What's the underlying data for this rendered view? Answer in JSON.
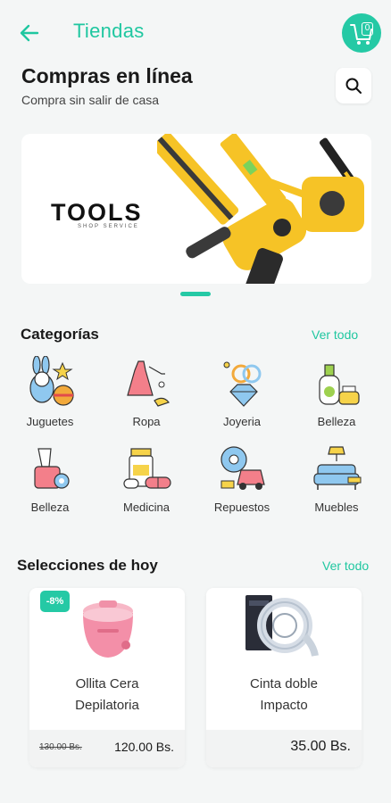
{
  "header": {
    "title": "Tiendas",
    "cart_count": "0"
  },
  "intro": {
    "heading": "Compras en línea",
    "subheading": "Compra sin salir de casa"
  },
  "banner": {
    "brand": "TOOLS",
    "tagline": "SHOP SERVICE"
  },
  "categories": {
    "title": "Categorías",
    "see_all": "Ver todo",
    "items": [
      {
        "label": "Juguetes",
        "icon": "toys-icon"
      },
      {
        "label": "Ropa",
        "icon": "dress-icon"
      },
      {
        "label": "Joyeria",
        "icon": "jewelry-icon"
      },
      {
        "label": "Belleza",
        "icon": "cosmetics-icon"
      },
      {
        "label": "Belleza",
        "icon": "makeup-icon"
      },
      {
        "label": "Medicina",
        "icon": "medicine-icon"
      },
      {
        "label": "Repuestos",
        "icon": "car-parts-icon"
      },
      {
        "label": "Muebles",
        "icon": "furniture-icon"
      }
    ]
  },
  "today": {
    "title": "Selecciones de hoy",
    "see_all": "Ver todo",
    "products": [
      {
        "name_line1": "Ollita Cera",
        "name_line2": "Depilatoria",
        "discount": "-8%",
        "old_price": "130.00 Bs.",
        "price": "120.00 Bs."
      },
      {
        "name_line1": "Cinta doble",
        "name_line2": "Impacto",
        "price": "35.00 Bs."
      }
    ]
  },
  "colors": {
    "accent": "#25c9a5",
    "background": "#f4f6f6"
  }
}
